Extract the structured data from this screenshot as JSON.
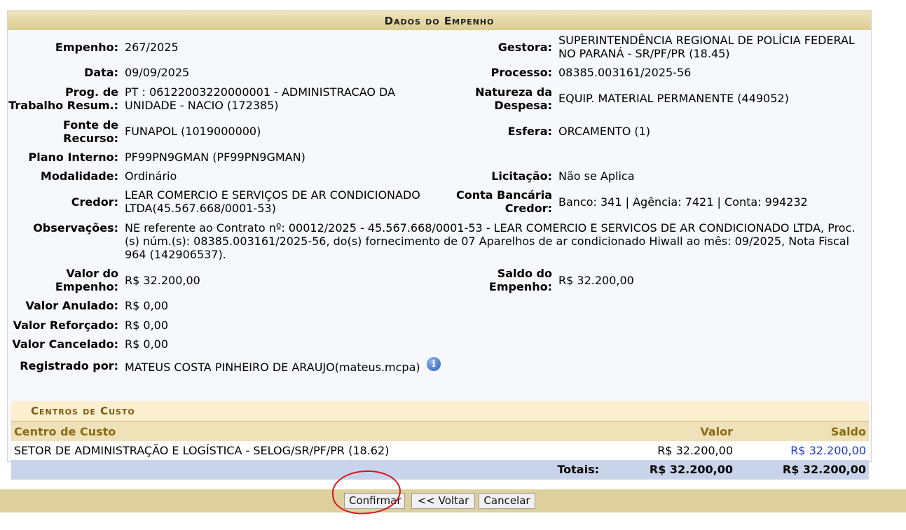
{
  "panel": {
    "title": "Dados do Empenho"
  },
  "fields": {
    "empenho": {
      "label": "Empenho:",
      "value": "267/2025"
    },
    "gestora": {
      "label": "Gestora:",
      "value_line1": "SUPERINTENDÊNCIA REGIONAL DE POLÍCIA FEDERAL",
      "value_line2": "NO PARANÁ - SR/PF/PR (18.45)"
    },
    "data": {
      "label": "Data:",
      "value": "09/09/2025"
    },
    "processo": {
      "label": "Processo:",
      "value": "08385.003161/2025-56"
    },
    "prog_trabalho": {
      "label_line1": "Prog. de",
      "label_line2": "Trabalho Resum.:",
      "value_line1": "PT : 06122003220000001 - ADMINISTRACAO DA",
      "value_line2": "UNIDADE - NACIO (172385)"
    },
    "natureza": {
      "label_line1": "Natureza da",
      "label_line2": "Despesa:",
      "value": "EQUIP. MATERIAL PERMANENTE (449052)"
    },
    "fonte": {
      "label_line1": "Fonte de",
      "label_line2": "Recurso:",
      "value": "FUNAPOL (1019000000)"
    },
    "esfera": {
      "label": "Esfera:",
      "value": "ORCAMENTO (1)"
    },
    "plano_interno": {
      "label": "Plano Interno:",
      "value": "PF99PN9GMAN (PF99PN9GMAN)"
    },
    "modalidade": {
      "label": "Modalidade:",
      "value": "Ordinário"
    },
    "licitacao": {
      "label": "Licitação:",
      "value": "Não se Aplica"
    },
    "credor": {
      "label": "Credor:",
      "value_line1": "LEAR COMERCIO E SERVIÇOS DE AR CONDICIONADO",
      "value_line2": "LTDA(45.567.668/0001-53)"
    },
    "conta": {
      "label_line1": "Conta Bancária",
      "label_line2": "Credor:",
      "value": "Banco: 341 | Agência: 7421 | Conta: 994232"
    },
    "observacoes": {
      "label": "Observações:",
      "value_line1": "NE referente ao Contrato nº: 00012/2025 - 45.567.668/0001-53 - LEAR COMERCIO E SERVICOS DE AR CONDICIONADO LTDA, Proc.",
      "value_line2": "(s) núm.(s): 08385.003161/2025-56, do(s) fornecimento de 07 Aparelhos de ar condicionado Hiwall ao mês: 09/2025, Nota Fiscal",
      "value_line3": "964 (142906537)."
    },
    "valor_empenho": {
      "label_line1": "Valor do",
      "label_line2": "Empenho:",
      "value": "R$ 32.200,00"
    },
    "saldo_empenho": {
      "label_line1": "Saldo do",
      "label_line2": "Empenho:",
      "value": "R$ 32.200,00"
    },
    "valor_anulado": {
      "label": "Valor Anulado:",
      "value": "R$ 0,00"
    },
    "valor_reforcado": {
      "label": "Valor Reforçado:",
      "value": "R$ 0,00"
    },
    "valor_cancelado": {
      "label": "Valor Cancelado:",
      "value": "R$ 0,00"
    },
    "registrado": {
      "label": "Registrado por:",
      "value": "MATEUS COSTA PINHEIRO DE ARAUJO(mateus.mcpa)",
      "icon": "info-icon"
    }
  },
  "centros": {
    "title": "Centros de Custo",
    "columns": {
      "centro": "Centro de Custo",
      "valor": "Valor",
      "saldo": "Saldo"
    },
    "rows": [
      {
        "centro": "SETOR DE ADMINISTRAÇÃO E LOGÍSTICA - SELOG/SR/PF/PR (18.62)",
        "valor": "R$ 32.200,00",
        "saldo": "R$ 32.200,00"
      }
    ],
    "totals": {
      "label": "Totais:",
      "valor": "R$ 32.200,00",
      "saldo": "R$ 32.200,00"
    }
  },
  "buttons": {
    "confirmar": "Confirmar",
    "voltar": "<< Voltar",
    "cancelar": "Cancelar"
  },
  "colors": {
    "header_gradient": "#dccb93",
    "button_bar": "#ddd09c",
    "annotation": "#d8141e",
    "link": "#1a3ad6"
  }
}
